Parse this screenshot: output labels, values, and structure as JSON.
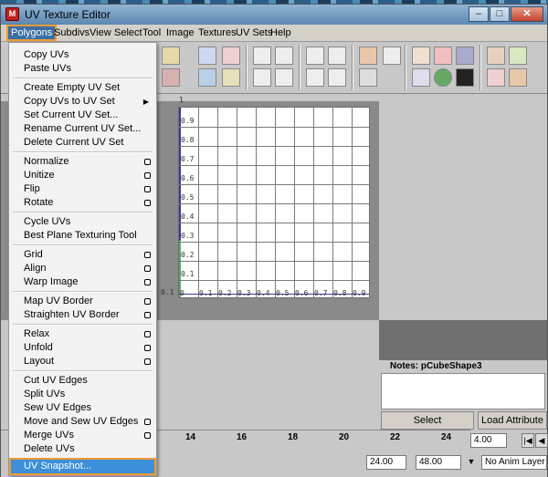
{
  "window": {
    "title": "UV Texture Editor"
  },
  "menubar": [
    "Polygons",
    "Subdivs",
    "View",
    "Select",
    "Tool",
    "Image",
    "Textures",
    "UV Sets",
    "Help"
  ],
  "menu": {
    "items": [
      {
        "label": "Copy UVs"
      },
      {
        "label": "Paste UVs"
      },
      {
        "label": "Create Empty UV Set"
      },
      {
        "label": "Copy UVs to UV Set",
        "submenu": true
      },
      {
        "label": "Set Current UV Set..."
      },
      {
        "label": "Rename Current UV Set..."
      },
      {
        "label": "Delete Current UV Set"
      },
      {
        "label": "Normalize",
        "option": true
      },
      {
        "label": "Unitize",
        "option": true
      },
      {
        "label": "Flip",
        "option": true
      },
      {
        "label": "Rotate",
        "option": true
      },
      {
        "label": "Cycle UVs"
      },
      {
        "label": "Best Plane Texturing Tool"
      },
      {
        "label": "Grid",
        "option": true
      },
      {
        "label": "Align",
        "option": true
      },
      {
        "label": "Warp Image",
        "option": true
      },
      {
        "label": "Map UV Border",
        "option": true
      },
      {
        "label": "Straighten UV Border",
        "option": true
      },
      {
        "label": "Relax",
        "option": true
      },
      {
        "label": "Unfold",
        "option": true
      },
      {
        "label": "Layout",
        "option": true
      },
      {
        "label": "Cut UV Edges"
      },
      {
        "label": "Split UVs"
      },
      {
        "label": "Sew UV Edges"
      },
      {
        "label": "Move and Sew UV Edges",
        "option": true
      },
      {
        "label": "Merge UVs",
        "option": true
      },
      {
        "label": "Delete UVs"
      },
      {
        "label": "UV Snapshot...",
        "highlight": true
      }
    ]
  },
  "grid": {
    "top_label": "1",
    "y_labels": [
      "0.9",
      "0.8",
      "0.7",
      "0.6",
      "0.5",
      "0.4",
      "0.3",
      "0.2",
      "0.1"
    ],
    "x_labels": [
      "0.1",
      "0",
      "0.1",
      "0.2",
      "0.3",
      "0.4",
      "0.5",
      "0.6",
      "0.7",
      "0.8",
      "0.9"
    ]
  },
  "notes": {
    "label": "Notes:  pCubeShape3"
  },
  "buttons": {
    "select": "Select",
    "load": "Load Attribute"
  },
  "timeline": {
    "ticks": [
      "14",
      "16",
      "18",
      "20",
      "22",
      "24"
    ],
    "current": "4.00"
  },
  "range": {
    "start": "24.00",
    "end": "48.00"
  },
  "anim_layer": "No Anim Layer"
}
